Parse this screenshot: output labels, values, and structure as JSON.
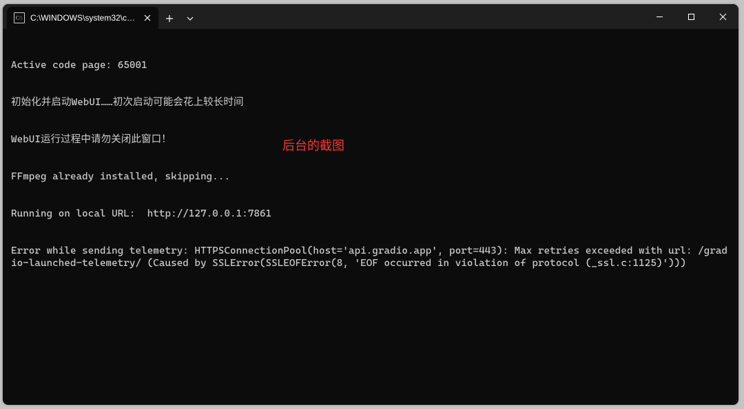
{
  "window": {
    "tab_title": "C:\\WINDOWS\\system32\\cmd."
  },
  "terminal": {
    "lines": [
      "Active code page: 65001",
      "初始化并启动WebUI……初次启动可能会花上较长时间",
      "WebUI运行过程中请勿关闭此窗口！",
      "FFmpeg already installed, skipping...",
      "Running on local URL:  http://127.0.0.1:7861",
      "Error while sending telemetry: HTTPSConnectionPool(host='api.gradio.app', port=443): Max retries exceeded with url: /gradio-launched-telemetry/ (Caused by SSLError(SSLEOFError(8, 'EOF occurred in violation of protocol (_ssl.c:1125)')))"
    ]
  },
  "annotation": "后台的截图"
}
